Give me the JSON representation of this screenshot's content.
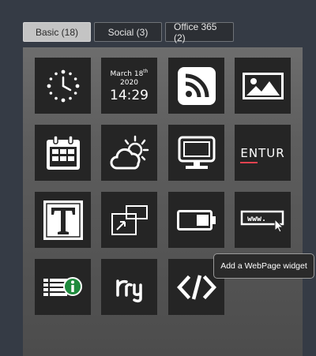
{
  "tabs": [
    {
      "label": "Basic (18)",
      "active": true
    },
    {
      "label": "Social (3)",
      "active": false
    },
    {
      "label": "Office 365 (2)",
      "active": false
    }
  ],
  "widgets": [
    {
      "name": "clock-widget",
      "icon": "analog-clock-icon"
    },
    {
      "name": "date-time-widget",
      "icon": "date-time-display",
      "month_day": "March 18",
      "day_suffix": "th",
      "year": "2020",
      "time": "14:29"
    },
    {
      "name": "rss-widget",
      "icon": "rss-icon"
    },
    {
      "name": "image-widget",
      "icon": "image-icon"
    },
    {
      "name": "calendar-widget",
      "icon": "calendar-icon"
    },
    {
      "name": "weather-widget",
      "icon": "weather-sun-cloud-icon"
    },
    {
      "name": "screen-widget",
      "icon": "monitor-icon"
    },
    {
      "name": "entur-widget",
      "icon": "entur-logo",
      "logo_text": "ENTUR"
    },
    {
      "name": "text-widget",
      "icon": "text-t-icon"
    },
    {
      "name": "scale-widget",
      "icon": "resize-icon"
    },
    {
      "name": "battery-widget",
      "icon": "battery-icon"
    },
    {
      "name": "webpage-widget",
      "icon": "www-cursor-icon",
      "icon_text": "www."
    },
    {
      "name": "info-list-widget",
      "icon": "info-list-icon"
    },
    {
      "name": "fry-widget",
      "icon": "fry-logo"
    },
    {
      "name": "code-widget",
      "icon": "code-icon"
    }
  ],
  "tooltip": {
    "text": "Add a WebPage widget"
  },
  "colors": {
    "background": "#353b45",
    "tile": "#252525",
    "active_tab": "#c4c4c4",
    "entur_accent": "#e2424f",
    "info_green": "#1f8a3d"
  }
}
